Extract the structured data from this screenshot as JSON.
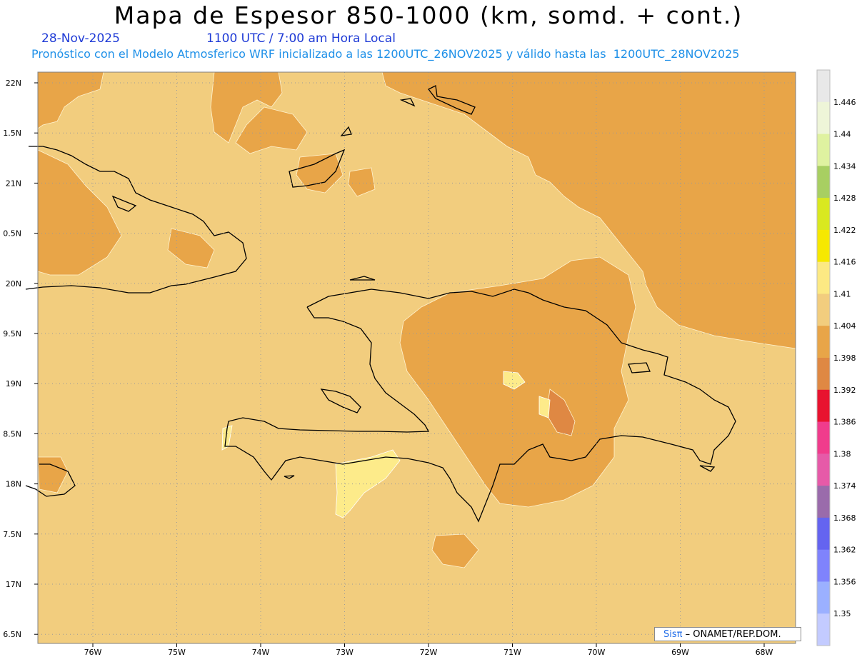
{
  "header": {
    "title": "Mapa de Espesor 850-1000 (km, somd. + cont.)",
    "date": "28-Nov-2025",
    "time": "1100 UTC / 7:00 am Hora Local",
    "description": "Pronóstico con el Modelo Atmosferico WRF inicializado a las 1200UTC_26NOV2025 y válido hasta las  1200UTC_28NOV2025"
  },
  "map": {
    "lat_labels": [
      "22N",
      "1.5N",
      "21N",
      "0.5N",
      "20N",
      "9.5N",
      "19N",
      "8.5N",
      "18N",
      "7.5N",
      "17N",
      "6.5N"
    ],
    "lon_labels": [
      "76W",
      "75W",
      "74W",
      "73W",
      "72W",
      "71W",
      "70W",
      "69W",
      "68W"
    ],
    "colors": {
      "shade_1398": "#e8a548",
      "shade_1404": "#f2cd7e",
      "shade_1410": "#fdeb8a",
      "shade_1392": "#e08a45",
      "coast": "#000000",
      "grid": "#9a9a9a"
    }
  },
  "colorbar": {
    "labels": [
      "1.446",
      "1.44",
      "1.434",
      "1.428",
      "1.422",
      "1.416",
      "1.41",
      "1.404",
      "1.398",
      "1.392",
      "1.386",
      "1.38",
      "1.374",
      "1.368",
      "1.362",
      "1.356",
      "1.35"
    ],
    "colors": [
      "#e8e8e8",
      "#eef5d8",
      "#dff2a0",
      "#a8cf62",
      "#d9e820",
      "#f6e800",
      "#fce983",
      "#f2cd7e",
      "#e8a548",
      "#df8843",
      "#e8132f",
      "#f03c8c",
      "#e65aa8",
      "#9a6bab",
      "#6464f0",
      "#7f83fc",
      "#9bb0ff",
      "#c3cbff"
    ]
  },
  "credit": {
    "prefix": "Sisπ",
    "text": "– ONAMET/REP.DOM."
  }
}
